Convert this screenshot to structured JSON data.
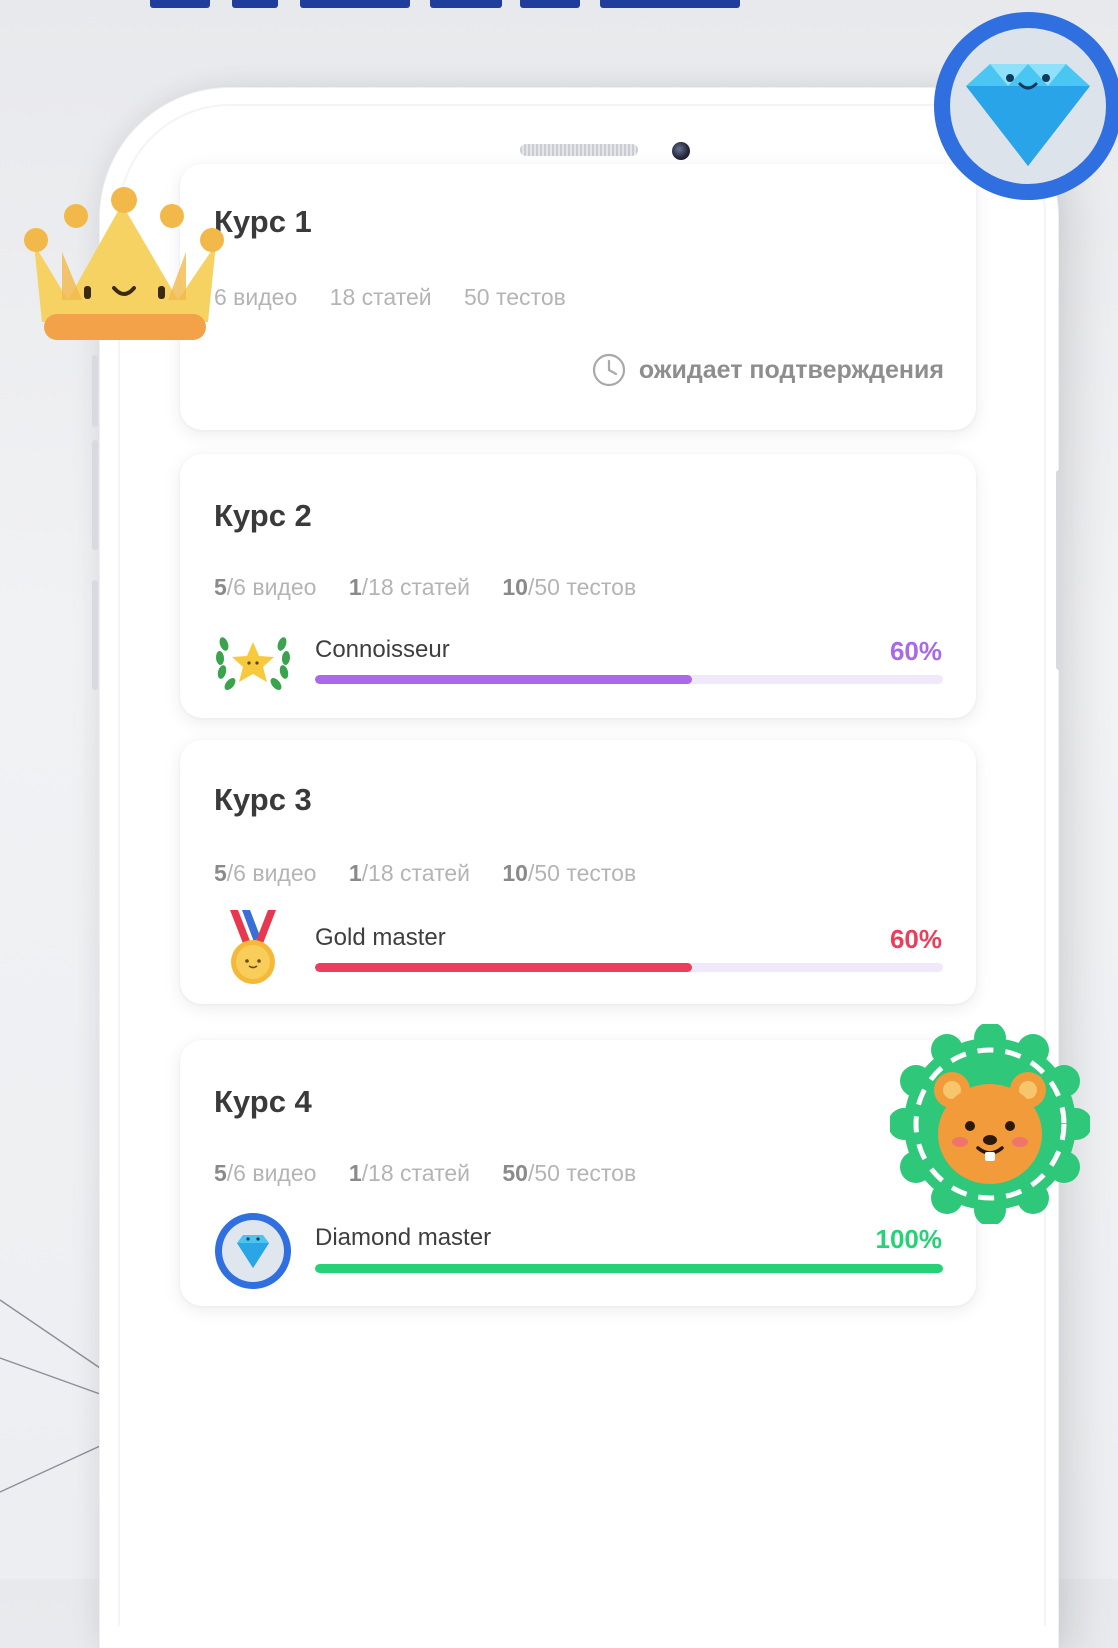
{
  "colors": {
    "connoisseur": "#a969e8",
    "gold": "#ea3e5c",
    "diamond": "#27d176",
    "track": "#f0e8fb",
    "brand_blue": "#2f6fe0"
  },
  "stickers": {
    "crown": "crown-icon",
    "diamond": "diamond-icon",
    "bear": "bear-icon"
  },
  "courses": [
    {
      "title": "Курс 1",
      "stats": [
        {
          "done": "",
          "total": "6 видео"
        },
        {
          "done": "",
          "total": "18 статей"
        },
        {
          "done": "",
          "total": "50 тестов"
        }
      ],
      "status": "ожидает подтверждения",
      "status_icon": "clock-icon"
    },
    {
      "title": "Курс 2",
      "stats": [
        {
          "done": "5",
          "total": "/6 видео"
        },
        {
          "done": "1",
          "total": "/18 статей"
        },
        {
          "done": "10",
          "total": "/50 тестов"
        }
      ],
      "badge": {
        "label": "Connoisseur",
        "icon": "laurel-star-icon"
      },
      "progress": {
        "label": "60%",
        "value": 0.6
      }
    },
    {
      "title": "Курс 3",
      "stats": [
        {
          "done": "5",
          "total": "/6 видео"
        },
        {
          "done": "1",
          "total": "/18 статей"
        },
        {
          "done": "10",
          "total": "/50 тестов"
        }
      ],
      "badge": {
        "label": "Gold master",
        "icon": "gold-medal-icon"
      },
      "progress": {
        "label": "60%",
        "value": 0.6
      }
    },
    {
      "title": "Курс 4",
      "stats": [
        {
          "done": "5",
          "total": "/6 видео"
        },
        {
          "done": "1",
          "total": "/18 статей"
        },
        {
          "done": "50",
          "total": "/50 тестов"
        }
      ],
      "badge": {
        "label": "Diamond master",
        "icon": "diamond-badge-icon"
      },
      "progress": {
        "label": "100%",
        "value": 1.0
      }
    }
  ]
}
